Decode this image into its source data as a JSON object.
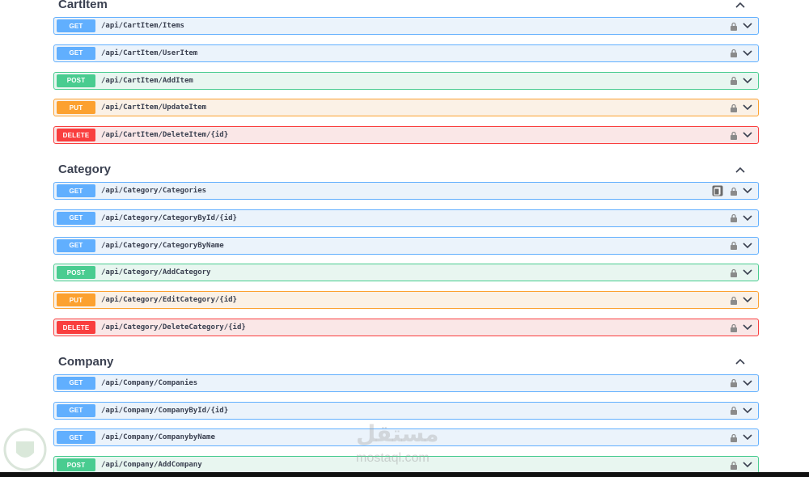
{
  "sections": [
    {
      "name": "CartItem",
      "ops": [
        {
          "method": "GET",
          "path": "/api/CartItem/Items"
        },
        {
          "method": "GET",
          "path": "/api/CartItem/UserItem"
        },
        {
          "method": "POST",
          "path": "/api/CartItem/AddItem"
        },
        {
          "method": "PUT",
          "path": "/api/CartItem/UpdateItem"
        },
        {
          "method": "DELETE",
          "path": "/api/CartItem/DeleteItem/{id}"
        }
      ]
    },
    {
      "name": "Category",
      "ops": [
        {
          "method": "GET",
          "path": "/api/Category/Categories"
        },
        {
          "method": "GET",
          "path": "/api/Category/CategoryById/{id}"
        },
        {
          "method": "GET",
          "path": "/api/Category/CategoryByName"
        },
        {
          "method": "POST",
          "path": "/api/Category/AddCategory"
        },
        {
          "method": "PUT",
          "path": "/api/Category/EditCategory/{id}"
        },
        {
          "method": "DELETE",
          "path": "/api/Category/DeleteCategory/{id}"
        }
      ]
    },
    {
      "name": "Company",
      "ops": [
        {
          "method": "GET",
          "path": "/api/Company/Companies"
        },
        {
          "method": "GET",
          "path": "/api/Company/CompanyById/{id}"
        },
        {
          "method": "GET",
          "path": "/api/Company/CompanybyName"
        },
        {
          "method": "POST",
          "path": "/api/Company/AddCompany"
        }
      ]
    }
  ],
  "watermark": {
    "arabic": "مستقل",
    "latin": "mostaql.com"
  },
  "colors": {
    "get": "#61affe",
    "post": "#49cc90",
    "put": "#fca130",
    "delete": "#f93e3e"
  }
}
